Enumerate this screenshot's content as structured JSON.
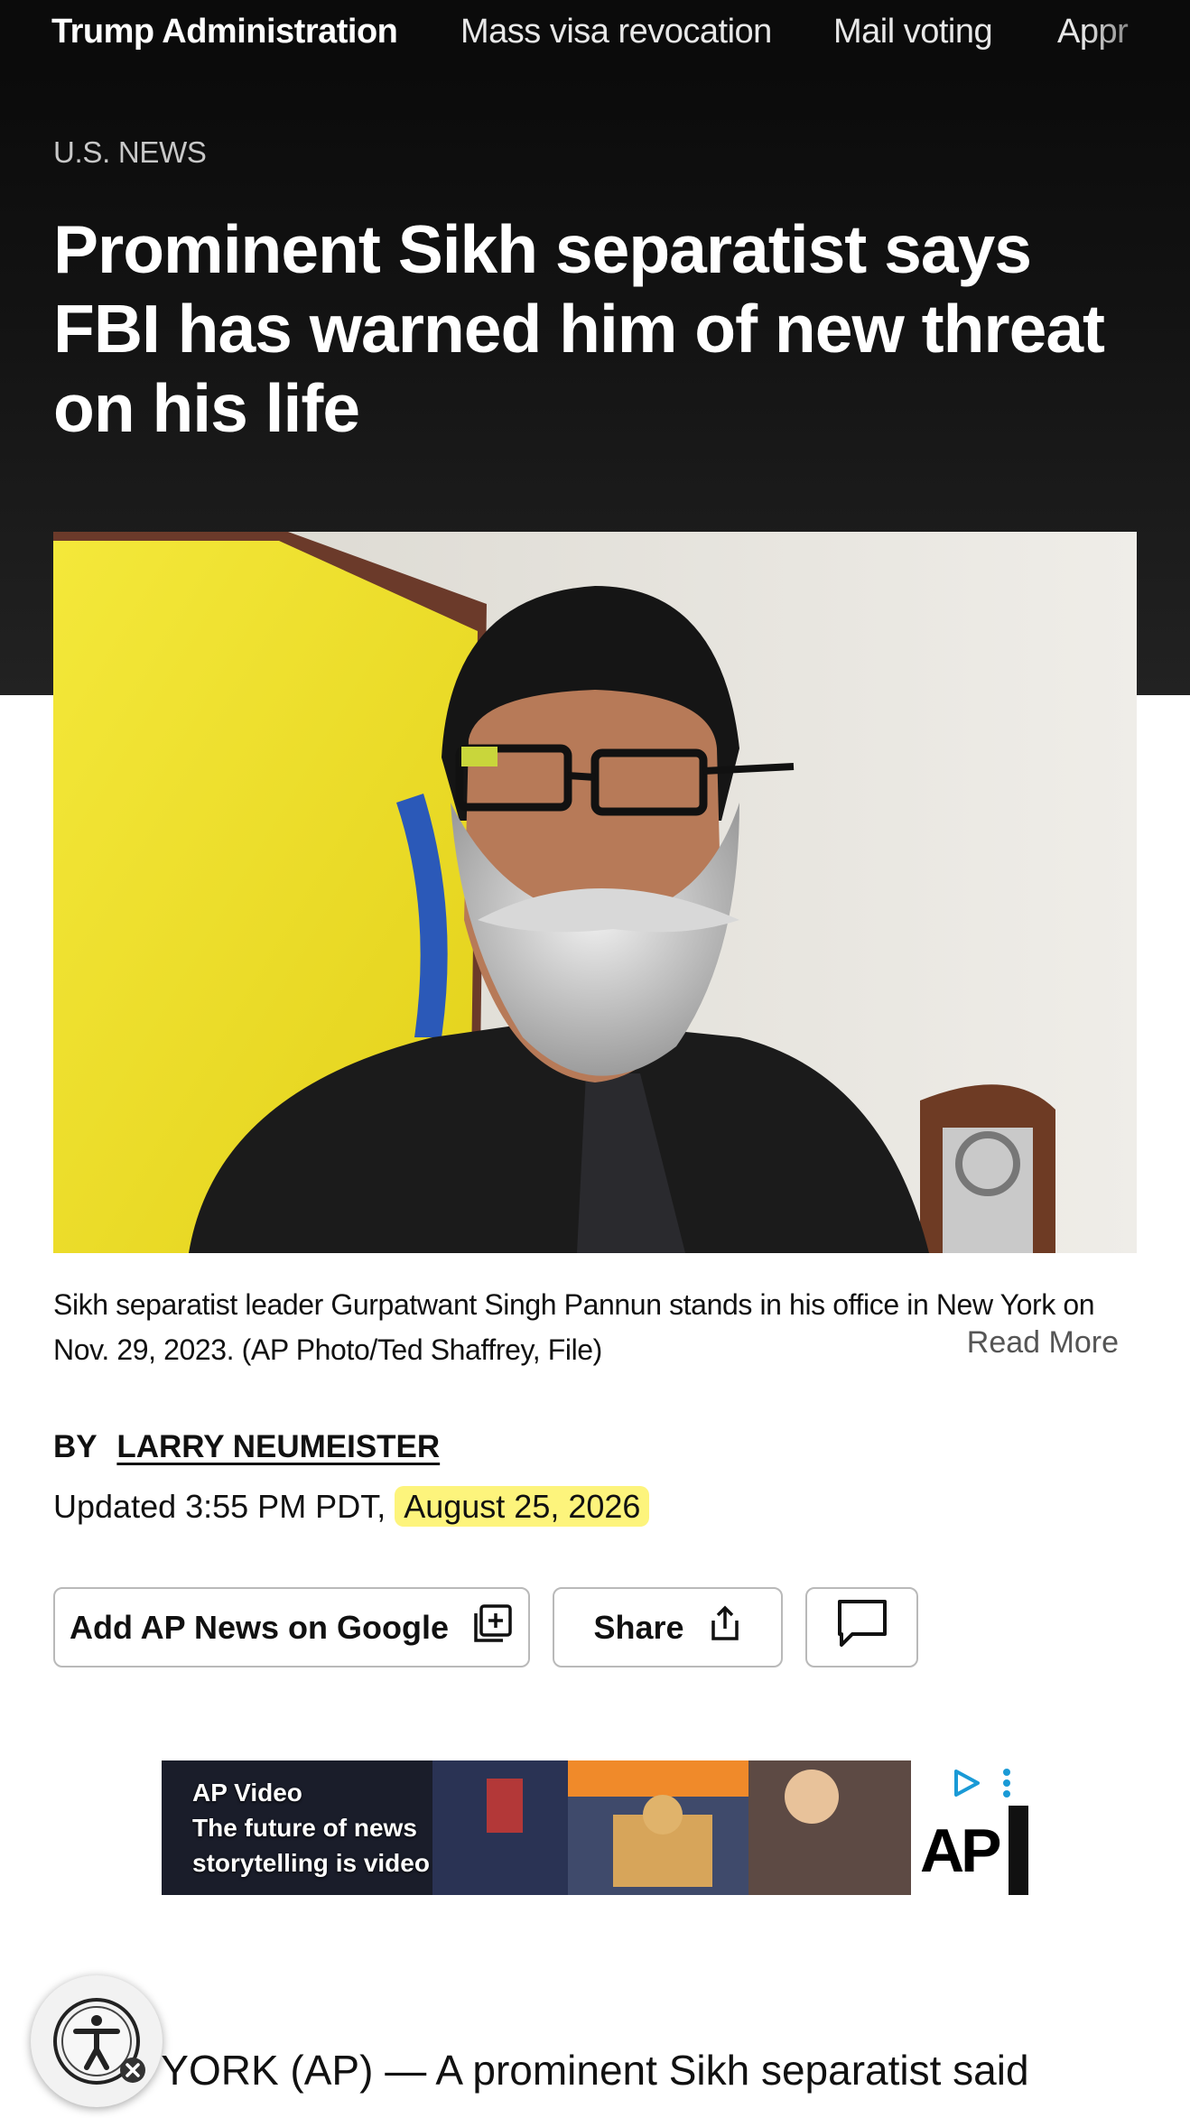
{
  "nav": {
    "items": [
      "Trump Administration",
      "Mass visa revocation",
      "Mail voting",
      "Appr"
    ]
  },
  "article": {
    "section": "U.S. NEWS",
    "headline": "Prominent Sikh separatist says FBI has warned him of new threat on his life",
    "caption": "Sikh separatist leader Gurpatwant Singh Pannun stands in his office in New York on Nov. 29, 2023. (AP Photo/Ted Shaffrey, File)",
    "read_more": "Read More",
    "byline_prefix": "BY",
    "author": "LARRY NEUMEISTER",
    "updated_prefix": "Updated 3:55 PM PDT,",
    "updated_date": "August 25, 2026",
    "lead_text": "NEW YORK (AP) — A prominent Sikh separatist said"
  },
  "actions": {
    "add_google": "Add AP News on Google",
    "share": "Share"
  },
  "ad": {
    "line1": "AP Video",
    "line2": "The future of news",
    "line3": "storytelling is video",
    "logo": "AP"
  },
  "colors": {
    "nav_bg": "#0b0b0b",
    "highlight": "#fdf47c",
    "flag_yellow": "#f1e321"
  },
  "icons": {
    "add": "add-box-icon",
    "share": "share-upload-icon",
    "comment": "comment-icon",
    "accessibility": "accessibility-icon"
  }
}
